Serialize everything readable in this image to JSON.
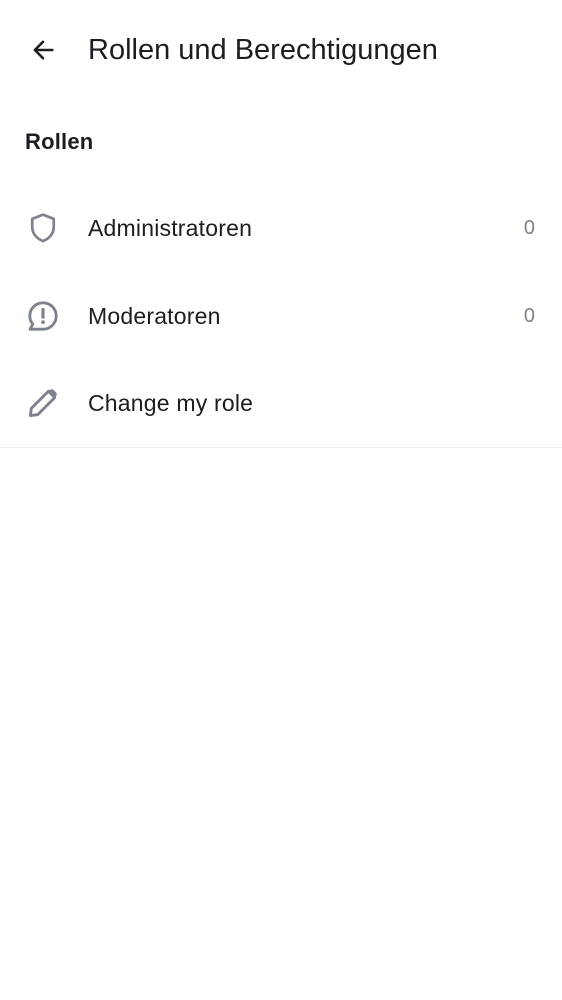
{
  "header": {
    "title": "Rollen und Berechtigungen",
    "back_icon": "arrow-left-icon"
  },
  "section": {
    "heading": "Rollen"
  },
  "roles": [
    {
      "icon": "shield-icon",
      "label": "Administratoren",
      "count": "0"
    },
    {
      "icon": "speech-bubble-alert-icon",
      "label": "Moderatoren",
      "count": "0"
    },
    {
      "icon": "pencil-icon",
      "label": "Change my role",
      "count": ""
    }
  ],
  "colors": {
    "text": "#1c1c22",
    "icon": "#7d828c",
    "count": "#7d828c",
    "divider": "#ececef",
    "background": "#ffffff"
  }
}
